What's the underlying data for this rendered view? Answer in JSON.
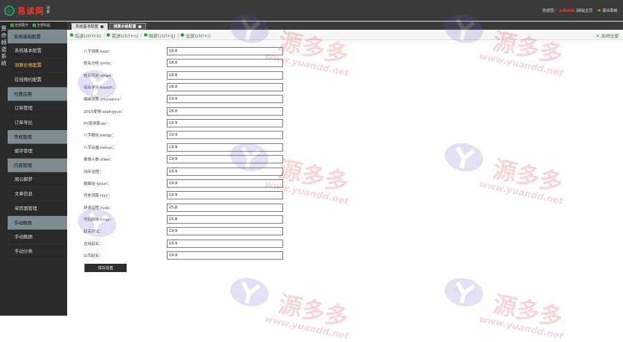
{
  "brand": {
    "name": "易读网",
    "tag_line1": "测",
    "tag_line2": "算"
  },
  "header": {
    "welcome": "欢迎您：",
    "username": "admin",
    "site_home": "网站主页",
    "exit": "退出系统"
  },
  "vertical_title": [
    "算",
    "命",
    "频",
    "道",
    "系",
    "统"
  ],
  "side_tools": {
    "expand_all": "全部展开",
    "collapse_all": "全部收起"
  },
  "sidebar": [
    {
      "type": "group",
      "label": "系统基础配置"
    },
    {
      "type": "item",
      "label": "系统基本配置"
    },
    {
      "type": "item",
      "label": "测算价格配置",
      "active": true
    },
    {
      "type": "item",
      "label": "在线预约配置"
    },
    {
      "type": "group",
      "label": "付费应用"
    },
    {
      "type": "item",
      "label": "订单管理"
    },
    {
      "type": "item",
      "label": "订单导出"
    },
    {
      "type": "group",
      "label": "常规管理"
    },
    {
      "type": "item",
      "label": "缓存管理"
    },
    {
      "type": "group",
      "label": "内容管理"
    },
    {
      "type": "item",
      "label": "周公解梦"
    },
    {
      "type": "item",
      "label": "文章信息"
    },
    {
      "type": "item",
      "label": "单页面管理"
    },
    {
      "type": "group",
      "label": "手动数据"
    },
    {
      "type": "item",
      "label": "手动数据"
    },
    {
      "type": "item",
      "label": "手动分类"
    }
  ],
  "tabs": [
    {
      "label": "系统基本配置",
      "active": false
    },
    {
      "label": "测算价格配置",
      "active": true
    }
  ],
  "toolbar": {
    "back": "后退(ctrl+b)",
    "forward": "前进(ctrl+n)",
    "refresh": "刷新(ctrl+q)",
    "fullscreen": "全屏(ctrl+i)",
    "close_all": "关闭全部"
  },
  "form": {
    "fields": [
      {
        "label": "八字测算-bazi：",
        "value": "18.8"
      },
      {
        "label": "姓名分析-xmfx：",
        "value": "18.8"
      },
      {
        "label": "姓名配对-xmpd：",
        "value": "18.8"
      },
      {
        "label": "综合详批-bazizh：",
        "value": "18.8"
      },
      {
        "label": "姻缘测算-yinyuancs：",
        "value": "19.9"
      },
      {
        "label": "2019爱情-aiqingyun：",
        "value": "18.8"
      },
      {
        "label": "PC版测算-pc：",
        "value": "19.9"
      },
      {
        "label": "八字精批-bazijp：",
        "value": "19.9"
      },
      {
        "label": "八字合婚-hehun：",
        "value": "19.9"
      },
      {
        "label": "紫微斗数-ziwei：",
        "value": "19.9"
      },
      {
        "label": "测年运程：",
        "value": "19.9"
      },
      {
        "label": "婚姻运-lvhun：",
        "value": "19.9"
      },
      {
        "label": "月老测算-lzyy：",
        "value": "19.9"
      },
      {
        "label": "詳测运程-xyds：",
        "value": "15.8"
      },
      {
        "label": "号码解析-hmjx：",
        "value": "15.8"
      },
      {
        "label": "起名测试：",
        "value": "19.9"
      },
      {
        "label": "在线起名：",
        "value": "19.9"
      },
      {
        "label": "公司起名：",
        "value": "19.9"
      }
    ],
    "save_label": "保存设置"
  },
  "watermark": {
    "text": "源多多",
    "url": "www.yuandd.net"
  },
  "colors": {
    "topbar": "#3a3a3a",
    "sidebar": "#2a2a2a",
    "group": "#7e8c92",
    "accent_green": "#2e9e44",
    "username_red": "#ff3030",
    "brand_red": "#e23b2b"
  }
}
